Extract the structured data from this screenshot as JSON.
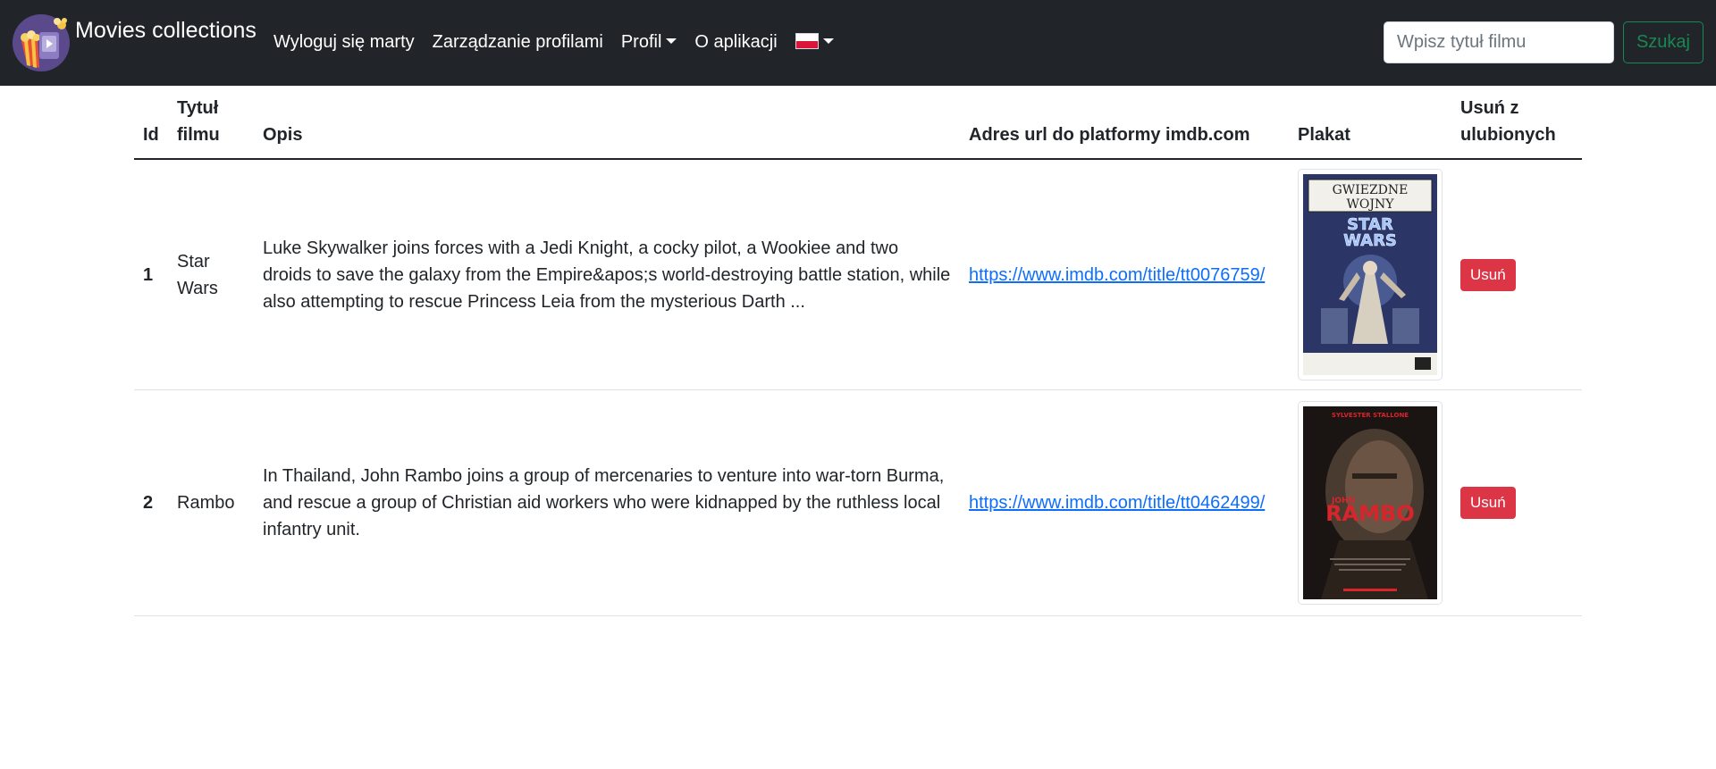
{
  "navbar": {
    "brand_text": "Movies collections",
    "links": {
      "logout": "Wyloguj się marty",
      "profiles": "Zarządzanie profilami",
      "profile": "Profil",
      "about": "O aplikacji"
    },
    "language_flag": "flag-pl-icon",
    "search": {
      "placeholder": "Wpisz tytuł filmu",
      "value": "",
      "button_label": "Szukaj"
    }
  },
  "table": {
    "headers": {
      "id": "Id",
      "title": "Tytuł filmu",
      "description": "Opis",
      "url": "Adres url do platformy imdb.com",
      "poster": "Plakat",
      "remove": "Usuń z ulubionych"
    },
    "rows": [
      {
        "id": "1",
        "title": "Star Wars",
        "description": "Luke Skywalker joins forces with a Jedi Knight, a cocky pilot, a Wookiee and two droids to save the galaxy from the Empire&apos;s world-destroying battle station, while also attempting to rescue Princess Leia from the mysterious Darth ...",
        "url": "https://www.imdb.com/title/tt0076759/",
        "poster": {
          "title_line1": "GWIEZDNE",
          "title_line2": "WOJNY",
          "subtitle_line1": "STAR",
          "subtitle_line2": "WARS"
        },
        "remove_label": "Usuń"
      },
      {
        "id": "2",
        "title": "Rambo",
        "description": "In Thailand, John Rambo joins a group of mercenaries to venture into war-torn Burma, and rescue a group of Christian aid workers who were kidnapped by the ruthless local infantry unit.",
        "url": "https://www.imdb.com/title/tt0462499/",
        "poster": {
          "top_text": "SYLVESTER STALLONE",
          "name_small": "JOHN",
          "name_big": "RAMBO"
        },
        "remove_label": "Usuń"
      }
    ]
  },
  "colors": {
    "navbar_bg": "#212529",
    "success": "#198754",
    "danger": "#dc3545",
    "link": "#0d6efd"
  }
}
